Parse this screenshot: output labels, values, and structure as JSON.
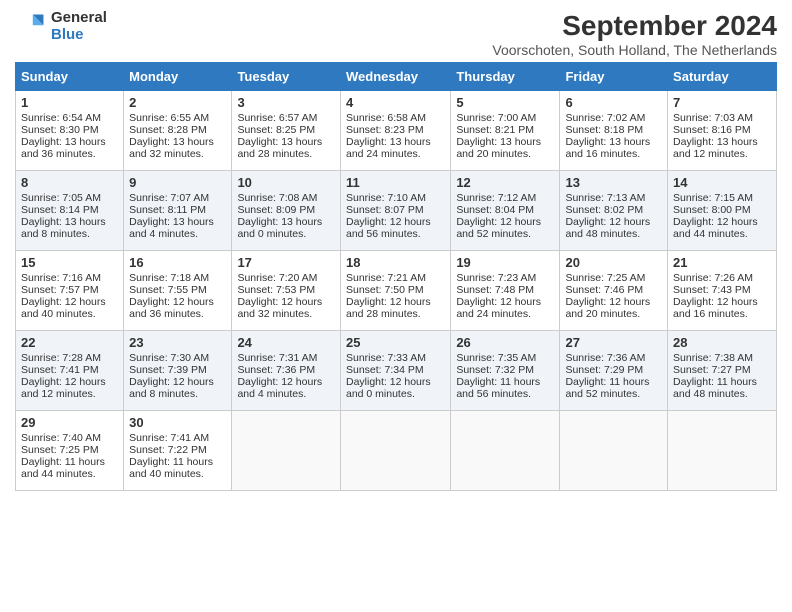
{
  "header": {
    "logo_line1": "General",
    "logo_line2": "Blue",
    "title": "September 2024",
    "subtitle": "Voorschoten, South Holland, The Netherlands"
  },
  "weekdays": [
    "Sunday",
    "Monday",
    "Tuesday",
    "Wednesday",
    "Thursday",
    "Friday",
    "Saturday"
  ],
  "weeks": [
    [
      {
        "day": "1",
        "info": "Sunrise: 6:54 AM\nSunset: 8:30 PM\nDaylight: 13 hours and 36 minutes."
      },
      {
        "day": "2",
        "info": "Sunrise: 6:55 AM\nSunset: 8:28 PM\nDaylight: 13 hours and 32 minutes."
      },
      {
        "day": "3",
        "info": "Sunrise: 6:57 AM\nSunset: 8:25 PM\nDaylight: 13 hours and 28 minutes."
      },
      {
        "day": "4",
        "info": "Sunrise: 6:58 AM\nSunset: 8:23 PM\nDaylight: 13 hours and 24 minutes."
      },
      {
        "day": "5",
        "info": "Sunrise: 7:00 AM\nSunset: 8:21 PM\nDaylight: 13 hours and 20 minutes."
      },
      {
        "day": "6",
        "info": "Sunrise: 7:02 AM\nSunset: 8:18 PM\nDaylight: 13 hours and 16 minutes."
      },
      {
        "day": "7",
        "info": "Sunrise: 7:03 AM\nSunset: 8:16 PM\nDaylight: 13 hours and 12 minutes."
      }
    ],
    [
      {
        "day": "8",
        "info": "Sunrise: 7:05 AM\nSunset: 8:14 PM\nDaylight: 13 hours and 8 minutes."
      },
      {
        "day": "9",
        "info": "Sunrise: 7:07 AM\nSunset: 8:11 PM\nDaylight: 13 hours and 4 minutes."
      },
      {
        "day": "10",
        "info": "Sunrise: 7:08 AM\nSunset: 8:09 PM\nDaylight: 13 hours and 0 minutes."
      },
      {
        "day": "11",
        "info": "Sunrise: 7:10 AM\nSunset: 8:07 PM\nDaylight: 12 hours and 56 minutes."
      },
      {
        "day": "12",
        "info": "Sunrise: 7:12 AM\nSunset: 8:04 PM\nDaylight: 12 hours and 52 minutes."
      },
      {
        "day": "13",
        "info": "Sunrise: 7:13 AM\nSunset: 8:02 PM\nDaylight: 12 hours and 48 minutes."
      },
      {
        "day": "14",
        "info": "Sunrise: 7:15 AM\nSunset: 8:00 PM\nDaylight: 12 hours and 44 minutes."
      }
    ],
    [
      {
        "day": "15",
        "info": "Sunrise: 7:16 AM\nSunset: 7:57 PM\nDaylight: 12 hours and 40 minutes."
      },
      {
        "day": "16",
        "info": "Sunrise: 7:18 AM\nSunset: 7:55 PM\nDaylight: 12 hours and 36 minutes."
      },
      {
        "day": "17",
        "info": "Sunrise: 7:20 AM\nSunset: 7:53 PM\nDaylight: 12 hours and 32 minutes."
      },
      {
        "day": "18",
        "info": "Sunrise: 7:21 AM\nSunset: 7:50 PM\nDaylight: 12 hours and 28 minutes."
      },
      {
        "day": "19",
        "info": "Sunrise: 7:23 AM\nSunset: 7:48 PM\nDaylight: 12 hours and 24 minutes."
      },
      {
        "day": "20",
        "info": "Sunrise: 7:25 AM\nSunset: 7:46 PM\nDaylight: 12 hours and 20 minutes."
      },
      {
        "day": "21",
        "info": "Sunrise: 7:26 AM\nSunset: 7:43 PM\nDaylight: 12 hours and 16 minutes."
      }
    ],
    [
      {
        "day": "22",
        "info": "Sunrise: 7:28 AM\nSunset: 7:41 PM\nDaylight: 12 hours and 12 minutes."
      },
      {
        "day": "23",
        "info": "Sunrise: 7:30 AM\nSunset: 7:39 PM\nDaylight: 12 hours and 8 minutes."
      },
      {
        "day": "24",
        "info": "Sunrise: 7:31 AM\nSunset: 7:36 PM\nDaylight: 12 hours and 4 minutes."
      },
      {
        "day": "25",
        "info": "Sunrise: 7:33 AM\nSunset: 7:34 PM\nDaylight: 12 hours and 0 minutes."
      },
      {
        "day": "26",
        "info": "Sunrise: 7:35 AM\nSunset: 7:32 PM\nDaylight: 11 hours and 56 minutes."
      },
      {
        "day": "27",
        "info": "Sunrise: 7:36 AM\nSunset: 7:29 PM\nDaylight: 11 hours and 52 minutes."
      },
      {
        "day": "28",
        "info": "Sunrise: 7:38 AM\nSunset: 7:27 PM\nDaylight: 11 hours and 48 minutes."
      }
    ],
    [
      {
        "day": "29",
        "info": "Sunrise: 7:40 AM\nSunset: 7:25 PM\nDaylight: 11 hours and 44 minutes."
      },
      {
        "day": "30",
        "info": "Sunrise: 7:41 AM\nSunset: 7:22 PM\nDaylight: 11 hours and 40 minutes."
      },
      {
        "day": "",
        "info": ""
      },
      {
        "day": "",
        "info": ""
      },
      {
        "day": "",
        "info": ""
      },
      {
        "day": "",
        "info": ""
      },
      {
        "day": "",
        "info": ""
      }
    ]
  ]
}
